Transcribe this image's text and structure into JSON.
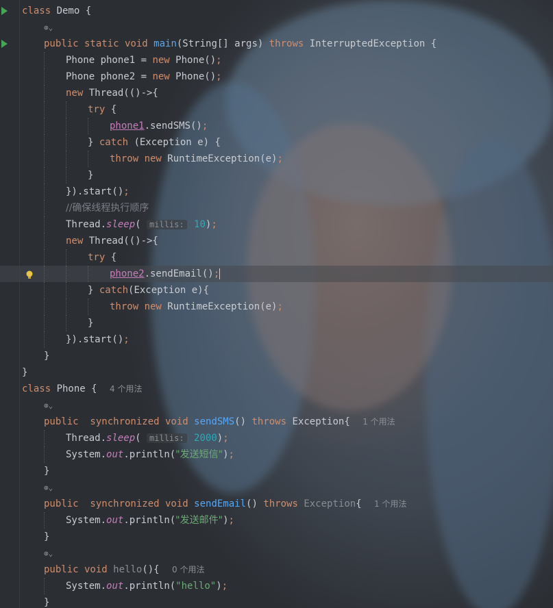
{
  "editor": {
    "language": "Java",
    "lines": [
      {
        "indent": 0,
        "tokens": [
          [
            "kw",
            "class "
          ],
          [
            "plain",
            "Demo {"
          ]
        ],
        "run": true
      },
      {
        "indent": 1,
        "lens": true
      },
      {
        "indent": 1,
        "tokens": [
          [
            "kw",
            "public static void "
          ],
          [
            "fn-decl",
            "main"
          ],
          [
            "plain",
            "(String[] args) "
          ],
          [
            "kw",
            "throws "
          ],
          [
            "plain",
            "InterruptedException {"
          ]
        ],
        "run": true
      },
      {
        "indent": 2,
        "tokens": [
          [
            "plain",
            "Phone phone1 = "
          ],
          [
            "kw",
            "new "
          ],
          [
            "plain",
            "Phone()"
          ],
          [
            "kw",
            ";"
          ]
        ]
      },
      {
        "indent": 2,
        "tokens": [
          [
            "plain",
            "Phone phone2 = "
          ],
          [
            "kw",
            "new "
          ],
          [
            "plain",
            "Phone()"
          ],
          [
            "kw",
            ";"
          ]
        ]
      },
      {
        "indent": 2,
        "tokens": [
          [
            "kw",
            "new "
          ],
          [
            "plain",
            "Thread(()->{"
          ]
        ]
      },
      {
        "indent": 3,
        "tokens": [
          [
            "kw",
            "try "
          ],
          [
            "plain",
            "{"
          ]
        ]
      },
      {
        "indent": 4,
        "tokens": [
          [
            "field",
            "phone1"
          ],
          [
            "plain",
            ".sendSMS()"
          ],
          [
            "kw",
            ";"
          ]
        ]
      },
      {
        "indent": 3,
        "tokens": [
          [
            "plain",
            "} "
          ],
          [
            "kw",
            "catch "
          ],
          [
            "plain",
            "(Exception e) {"
          ]
        ]
      },
      {
        "indent": 4,
        "tokens": [
          [
            "kw",
            "throw new "
          ],
          [
            "plain",
            "RuntimeException(e)"
          ],
          [
            "kw",
            ";"
          ]
        ]
      },
      {
        "indent": 3,
        "tokens": [
          [
            "plain",
            "}"
          ]
        ]
      },
      {
        "indent": 2,
        "tokens": [
          [
            "plain",
            "}).start()"
          ],
          [
            "kw",
            ";"
          ]
        ]
      },
      {
        "indent": 2,
        "tokens": [
          [
            "cmt",
            "//确保线程执行顺序"
          ]
        ]
      },
      {
        "indent": 2,
        "tokens": [
          [
            "plain",
            "Thread."
          ],
          [
            "ita",
            "sleep"
          ],
          [
            "plain",
            "( "
          ],
          [
            "hint",
            "millis:"
          ],
          [
            "num",
            " 10"
          ],
          [
            "plain",
            ")"
          ],
          [
            "kw",
            ";"
          ]
        ]
      },
      {
        "indent": 2,
        "tokens": [
          [
            "kw",
            "new "
          ],
          [
            "plain",
            "Thread(()->{"
          ]
        ]
      },
      {
        "indent": 3,
        "tokens": [
          [
            "kw",
            "try "
          ],
          [
            "plain",
            "{"
          ]
        ]
      },
      {
        "indent": 4,
        "tokens": [
          [
            "field",
            "phone2"
          ],
          [
            "plain",
            ".sendEmail()"
          ],
          [
            "kw",
            ";"
          ],
          [
            "caret",
            ""
          ]
        ],
        "current": true,
        "bulb": true
      },
      {
        "indent": 3,
        "tokens": [
          [
            "plain",
            "} "
          ],
          [
            "kw",
            "catch"
          ],
          [
            "plain",
            "(Exception e){"
          ]
        ]
      },
      {
        "indent": 4,
        "tokens": [
          [
            "kw",
            "throw new "
          ],
          [
            "plain",
            "RuntimeException(e)"
          ],
          [
            "kw",
            ";"
          ]
        ]
      },
      {
        "indent": 3,
        "tokens": [
          [
            "plain",
            "}"
          ]
        ]
      },
      {
        "indent": 2,
        "tokens": [
          [
            "plain",
            "}).start()"
          ],
          [
            "kw",
            ";"
          ]
        ]
      },
      {
        "indent": 1,
        "tokens": [
          [
            "plain",
            "}"
          ]
        ]
      },
      {
        "indent": 0,
        "tokens": [
          [
            "plain",
            "}"
          ]
        ]
      },
      {
        "indent": 0,
        "tokens": [
          [
            "kw",
            "class "
          ],
          [
            "plain",
            "Phone { "
          ],
          [
            "usage",
            "4 个用法"
          ]
        ]
      },
      {
        "indent": 1,
        "lens": true
      },
      {
        "indent": 1,
        "tokens": [
          [
            "kw",
            "public  synchronized void "
          ],
          [
            "fn-decl",
            "sendSMS"
          ],
          [
            "plain",
            "() "
          ],
          [
            "kw",
            "throws "
          ],
          [
            "plain",
            "Exception{ "
          ],
          [
            "usage",
            "1 个用法"
          ]
        ]
      },
      {
        "indent": 2,
        "tokens": [
          [
            "plain",
            "Thread."
          ],
          [
            "ita",
            "sleep"
          ],
          [
            "plain",
            "( "
          ],
          [
            "hint",
            "millis:"
          ],
          [
            "num",
            " 2000"
          ],
          [
            "plain",
            ")"
          ],
          [
            "kw",
            ";"
          ]
        ]
      },
      {
        "indent": 2,
        "tokens": [
          [
            "plain",
            "System."
          ],
          [
            "ita",
            "out"
          ],
          [
            "plain",
            ".println("
          ],
          [
            "str",
            "\"发送短信\""
          ],
          [
            "plain",
            ")"
          ],
          [
            "kw",
            ";"
          ]
        ]
      },
      {
        "indent": 1,
        "tokens": [
          [
            "plain",
            "}"
          ]
        ]
      },
      {
        "indent": 1,
        "lens": true
      },
      {
        "indent": 1,
        "tokens": [
          [
            "kw",
            "public  synchronized void "
          ],
          [
            "fn-decl",
            "sendEmail"
          ],
          [
            "plain",
            "() "
          ],
          [
            "kw",
            "throws "
          ],
          [
            "dim",
            "Exception"
          ],
          [
            "plain",
            "{ "
          ],
          [
            "usage",
            "1 个用法"
          ]
        ]
      },
      {
        "indent": 2,
        "tokens": [
          [
            "plain",
            "System."
          ],
          [
            "ita",
            "out"
          ],
          [
            "plain",
            ".println("
          ],
          [
            "str",
            "\"发送邮件\""
          ],
          [
            "plain",
            ")"
          ],
          [
            "kw",
            ";"
          ]
        ]
      },
      {
        "indent": 1,
        "tokens": [
          [
            "plain",
            "}"
          ]
        ]
      },
      {
        "indent": 1,
        "lens": true
      },
      {
        "indent": 1,
        "tokens": [
          [
            "kw",
            "public void "
          ],
          [
            "dim",
            "hello"
          ],
          [
            "plain",
            "(){ "
          ],
          [
            "usage",
            "0 个用法"
          ]
        ]
      },
      {
        "indent": 2,
        "tokens": [
          [
            "plain",
            "System."
          ],
          [
            "ita",
            "out"
          ],
          [
            "plain",
            ".println("
          ],
          [
            "str",
            "\"hello\""
          ],
          [
            "plain",
            ")"
          ],
          [
            "kw",
            ";"
          ]
        ]
      },
      {
        "indent": 1,
        "tokens": [
          [
            "plain",
            "}"
          ]
        ]
      },
      {
        "indent": 0,
        "tokens": [
          [
            "plain",
            " }"
          ]
        ]
      }
    ]
  }
}
